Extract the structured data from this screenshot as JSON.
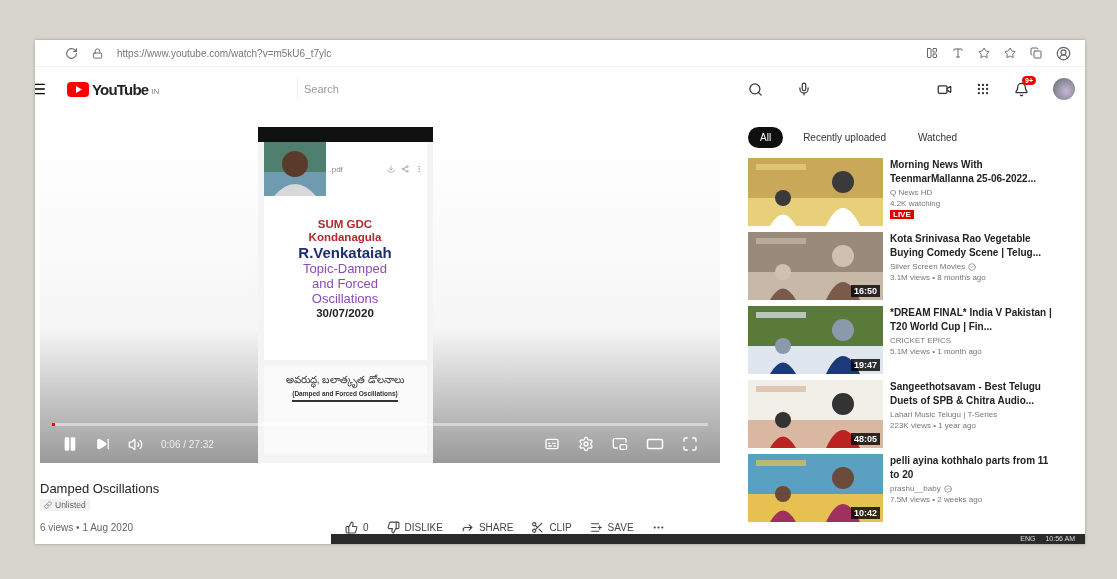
{
  "browser": {
    "url": "https://www.youtube.com/watch?v=m5kU6_t7ylc"
  },
  "header": {
    "logo": "YouTube",
    "region": "IN",
    "search": {
      "placeholder": "Search"
    },
    "notifications": "9+"
  },
  "video": {
    "playing": true,
    "time": "0:06 / 27:32",
    "progress": {
      "level": 0.004
    },
    "slide": {
      "file": ".pdf",
      "lines": [
        {
          "kind": "institution",
          "text": "SUM GDC"
        },
        {
          "kind": "institution",
          "text": "Kondanagula"
        },
        {
          "kind": "name",
          "text": "R.Venkataiah"
        },
        {
          "kind": "topic",
          "text": "Topic-Damped"
        },
        {
          "kind": "topic",
          "text": "and Forced"
        },
        {
          "kind": "topic",
          "text": "Oscillations"
        },
        {
          "kind": "date",
          "text": "30/07/2020"
        }
      ],
      "note_title": "అవరుద్ధ, బలాత్కృత డోలనాలు",
      "note_subtitle": "(Damped and Forced Oscillations)"
    }
  },
  "title": "Damped Oscillations",
  "visibility": "Unlisted",
  "meta": "6 views • 1 Aug 2020",
  "actions": [
    {
      "kind": "like",
      "label": "0"
    },
    {
      "kind": "dislike",
      "label": "DISLIKE"
    },
    {
      "kind": "share",
      "label": "SHARE"
    },
    {
      "kind": "clip",
      "label": "CLIP"
    },
    {
      "kind": "save",
      "label": "SAVE"
    },
    {
      "kind": "more"
    }
  ],
  "chips": [
    {
      "label": "All",
      "selected": true
    },
    {
      "label": "Recently uploaded",
      "selected": false
    },
    {
      "label": "Watched",
      "selected": false
    }
  ],
  "recommendations": [
    {
      "title": "Morning News With TeenmarMallanna 25-06-2022...",
      "channel": "Q News HD",
      "verified": false,
      "stats": "4.2K watching",
      "live": "LIVE"
    },
    {
      "title": "Kota Srinivasa Rao Vegetable Buying Comedy Scene | Telug...",
      "channel": "Silver Screen Movies",
      "verified": true,
      "stats": "3.1M views • 8 months ago",
      "duration": "16:50"
    },
    {
      "title": "*DREAM FINAL* India V Pakistan | T20 World Cup | Fin...",
      "channel": "CRICKET EPICS",
      "verified": false,
      "stats": "5.1M views • 1 month ago",
      "duration": "19:47"
    },
    {
      "title": "Sangeethotsavam - Best Telugu Duets of SPB & Chitra Audio...",
      "channel": "Lahari Music Telugu | T-Series",
      "verified": false,
      "stats": "223K views • 1 year ago",
      "duration": "48:05"
    },
    {
      "title": "pelli ayina kothhalo parts from 11 to 20",
      "channel": "prashu__baby",
      "verified": true,
      "stats": "7.5M views • 2 weeks ago",
      "duration": "10:42"
    }
  ],
  "taskbar": {
    "language": "ENG",
    "time": "10:56 AM"
  }
}
